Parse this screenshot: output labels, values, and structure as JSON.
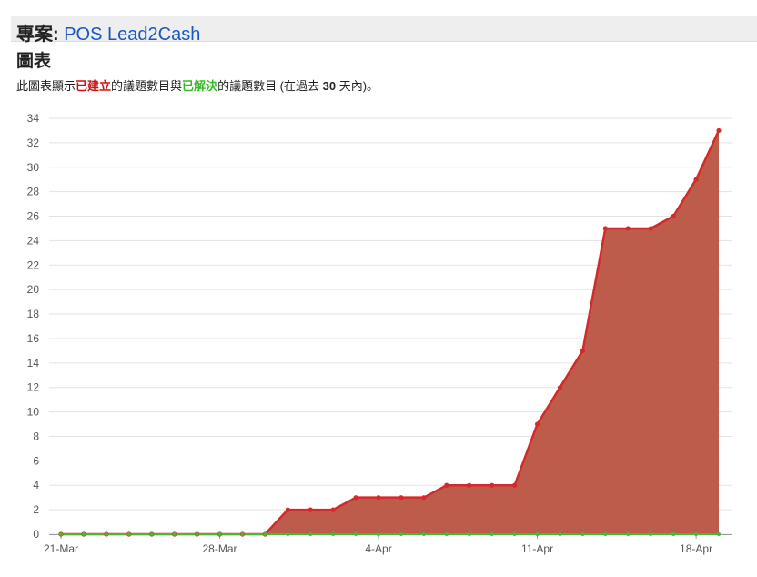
{
  "header": {
    "project_prefix": "專案: ",
    "project_name": "POS Lead2Cash"
  },
  "section": {
    "title": "圖表"
  },
  "description": {
    "part1": "此圖表顯示",
    "created": "已建立",
    "part2": "的議題數目與",
    "resolved": "已解決",
    "part3": "的議題數目 (在過去 ",
    "days": "30",
    "part4": " 天內)。"
  },
  "colors": {
    "created_line": "#d42a2a",
    "created_fill": "#bd5c4b",
    "resolved_line": "#44bb33",
    "grid": "#e3e3e3",
    "axis": "#999999"
  },
  "chart_data": {
    "type": "area",
    "title": "",
    "xlabel": "",
    "ylabel": "",
    "ylim": [
      0,
      34
    ],
    "yticks": [
      0,
      2,
      4,
      6,
      8,
      10,
      12,
      14,
      16,
      18,
      20,
      22,
      24,
      26,
      28,
      30,
      32,
      34
    ],
    "x_tick_labels": [
      {
        "label": "21-Mar",
        "index": 0
      },
      {
        "label": "28-Mar",
        "index": 7
      },
      {
        "label": "4-Apr",
        "index": 14
      },
      {
        "label": "11-Apr",
        "index": 21
      },
      {
        "label": "18-Apr",
        "index": 28
      }
    ],
    "x": [
      "21-Mar",
      "22-Mar",
      "23-Mar",
      "24-Mar",
      "25-Mar",
      "26-Mar",
      "27-Mar",
      "28-Mar",
      "29-Mar",
      "30-Mar",
      "31-Mar",
      "1-Apr",
      "2-Apr",
      "3-Apr",
      "4-Apr",
      "5-Apr",
      "6-Apr",
      "7-Apr",
      "8-Apr",
      "9-Apr",
      "10-Apr",
      "11-Apr",
      "12-Apr",
      "13-Apr",
      "14-Apr",
      "15-Apr",
      "16-Apr",
      "17-Apr",
      "18-Apr",
      "19-Apr"
    ],
    "grid": true,
    "series": [
      {
        "key": "created",
        "values": [
          0,
          0,
          0,
          0,
          0,
          0,
          0,
          0,
          0,
          0,
          2,
          2,
          2,
          3,
          3,
          3,
          3,
          4,
          4,
          4,
          4,
          9,
          12,
          15,
          25,
          25,
          25,
          26,
          29,
          33
        ]
      },
      {
        "key": "resolved",
        "values": [
          0,
          0,
          0,
          0,
          0,
          0,
          0,
          0,
          0,
          0,
          0,
          0,
          0,
          0,
          0,
          0,
          0,
          0,
          0,
          0,
          0,
          0,
          0,
          0,
          0,
          0,
          0,
          0,
          0,
          0
        ]
      }
    ]
  }
}
